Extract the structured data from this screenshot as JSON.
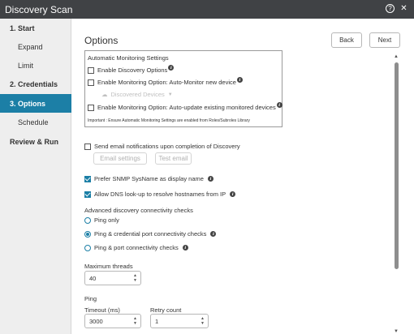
{
  "window": {
    "title": "Discovery Scan",
    "help_icon": "question-circle-icon",
    "close_icon": "close-icon"
  },
  "sidebar": {
    "steps": [
      {
        "label": "1. Start"
      },
      {
        "label": "Expand"
      },
      {
        "label": "Limit"
      },
      {
        "label": "2. Credentials"
      },
      {
        "label": "3. Options"
      },
      {
        "label": "Schedule"
      },
      {
        "label": "Review & Run"
      }
    ],
    "active_step": "3. Options"
  },
  "main": {
    "title": "Options",
    "back_label": "Back",
    "next_label": "Next",
    "auto_monitoring": {
      "heading": "Automatic Monitoring Settings",
      "enable_discovery_options": {
        "label": "Enable Discovery Options",
        "checked": false
      },
      "auto_monitor_new": {
        "label": "Enable Monitoring Option: Auto-Monitor new device",
        "checked": false
      },
      "devices_dropdown": {
        "label": "Discovered Devices",
        "icon": "cloud-icon"
      },
      "auto_update_existing": {
        "label": "Enable Monitoring Option: Auto-update existing monitored devices",
        "checked": false
      },
      "note": "Important : Ensure Automatic Monitoring Settings are enabled from Roles/Subroles Library"
    },
    "email": {
      "label": "Send email notifications upon completion of Discovery",
      "checked": false,
      "settings_label": "Email settings",
      "test_label": "Test email"
    },
    "prefer_snmp": {
      "label": "Prefer SNMP SysName as display name",
      "checked": true
    },
    "allow_dns": {
      "label": "Allow DNS look-up to resolve hostnames from IP",
      "checked": true
    },
    "connectivity": {
      "heading": "Advanced discovery connectivity checks",
      "options": [
        {
          "label": "Ping only",
          "checked": false
        },
        {
          "label": "Ping & credential port connectivity checks",
          "checked": true
        },
        {
          "label": "Ping & port connectivity checks",
          "checked": false
        }
      ]
    },
    "max_threads": {
      "label": "Maximum threads",
      "value": "40"
    },
    "ping": {
      "heading": "Ping",
      "timeout_label": "Timeout (ms)",
      "timeout_value": "3000",
      "retry_label": "Retry count",
      "retry_value": "1"
    }
  },
  "colors": {
    "accent": "#1c7fa6",
    "titlebar": "#404245",
    "sidebar_bg": "#eeeeee"
  }
}
